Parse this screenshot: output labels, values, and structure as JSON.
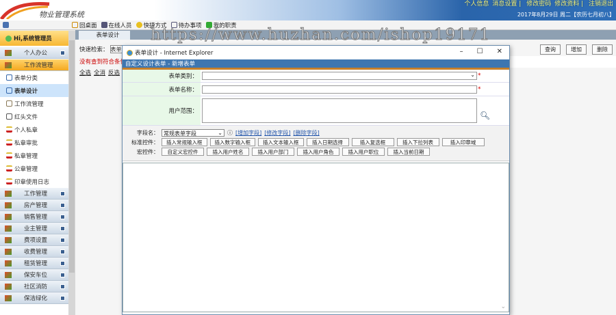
{
  "header": {
    "title": "物业管理系统",
    "links": [
      "个人信息",
      "消息设置",
      "修改密码",
      "修改资料",
      "注销退出"
    ],
    "date": "2017年8月29日 周二【农历七月初八】"
  },
  "toolbar": [
    "回桌面",
    "在线人员",
    "快捷方式",
    "待办事项",
    "我的职责"
  ],
  "sidebar": {
    "greeting": "Hi,系统管理员",
    "personal": "个人办公",
    "workflow": "工作流管理",
    "sub": [
      "表单分类",
      "表单设计",
      "工作流管理",
      "红头文件",
      "个人私章",
      "私章审批",
      "私章管理",
      "公章管理",
      "印章使用日志"
    ],
    "groups": [
      "工作管理",
      "房产管理",
      "销售管理",
      "业主管理",
      "费项设置",
      "收费管理",
      "租赁管理",
      "保安车位",
      "社区消防",
      "保洁绿化"
    ]
  },
  "main": {
    "tab": "表单设计",
    "quick_search_label": "快速检索：",
    "quick_search_value": "表单",
    "warning": "没有查到符合条件",
    "select_links": [
      "全选",
      "全消",
      "反选"
    ],
    "buttons": [
      "查询",
      "增加",
      "删除"
    ]
  },
  "dialog": {
    "window_title": "表单设计 - Internet Explorer",
    "header": "自定义设计表单 - 新增表单",
    "category_label": "表单类别：",
    "name_label": "表单名称：",
    "scope_label": "用户范围：",
    "field_label": "字段名：",
    "field_value": "常规表单字段",
    "field_links": [
      "[增加字段]",
      "[修改字段]",
      "[删除字段]"
    ],
    "std_label": "标准控件：",
    "std_buttons": [
      "插入常规输入框",
      "插入数字输入框",
      "插入文本输入框",
      "插入日期选择",
      "插入复选框",
      "插入下拉列表",
      "插入印章域"
    ],
    "macro_label": "宏控件：",
    "macro_buttons": [
      "自定义宏控件",
      "插入用户姓名",
      "插入用户部门",
      "插入用户角色",
      "插入用户职位",
      "插入当前日期"
    ]
  },
  "watermark": "https://www.huzhan.com/ishop19171"
}
